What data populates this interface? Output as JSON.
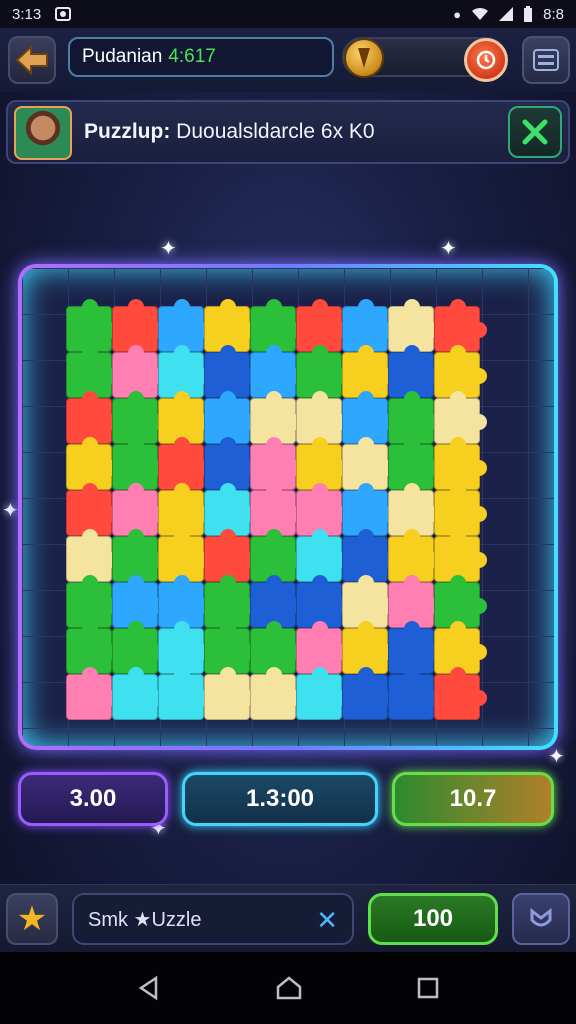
{
  "status_bar": {
    "time": "3:13",
    "right_time": "8:8",
    "icons": [
      "image-notification-icon",
      "notification-icon",
      "wifi-icon",
      "signal-icon",
      "battery-icon"
    ]
  },
  "top_bar": {
    "back_icon": "back-arrow-icon",
    "title": "Pudanian",
    "title_value": "4:617",
    "coin_icon": "coin-icon",
    "timer_icon": "timer-icon",
    "menu_icon": "menu-icon"
  },
  "banner": {
    "title_bold": "Puzzlup:",
    "title_rest": "Duoualsldarcle 6x K0",
    "close_icon": "close-icon"
  },
  "board": {
    "piece_colors": [
      "#2ea7ff",
      "#f7cf1f",
      "#ff7fb3",
      "#2bbf3a",
      "#ff4a3d",
      "#1f5fd6",
      "#3fe0f0",
      "#f5e3a0"
    ]
  },
  "stats": {
    "left": "3.00",
    "center": "1.3:00",
    "right": "10.7"
  },
  "bottom_bar": {
    "star_icon": "star-icon",
    "search_text": "Smk ★Uzzle",
    "search_clear_icon": "close-icon",
    "score": "100",
    "shield_icon": "shield-icon"
  },
  "nav_bar": {
    "icons": [
      "back-triangle-icon",
      "home-icon",
      "recents-square-icon"
    ]
  }
}
